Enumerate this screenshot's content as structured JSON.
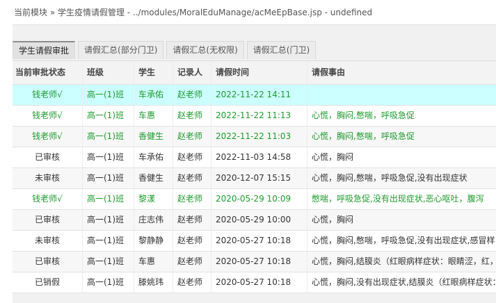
{
  "breadcrumb": "当前模块 » 学生疫情请假管理 - ../modules/MoralEduManage/acMeEpBase.jsp - undefined",
  "tabs": [
    {
      "label": "学生请假审批",
      "active": true
    },
    {
      "label": "请假汇总(部分门卫)",
      "active": false
    },
    {
      "label": "请假汇总(无权限)",
      "active": false
    },
    {
      "label": "请假汇总(门卫)",
      "active": false
    }
  ],
  "columns": {
    "status": "当前审批状态",
    "class": "班级",
    "student": "学生",
    "recorder": "记录人",
    "time": "请假时间",
    "reason": "请假事由"
  },
  "colors": {
    "approved_text": "#1f9a2e",
    "highlight_row": "#ccffff"
  },
  "rows": [
    {
      "status": "钱老师√",
      "class": "高一(1)班",
      "student": "车承佑",
      "recorder": "赵老师",
      "time": "2022-11-22 14:11",
      "reason": ""
    },
    {
      "status": "钱老师√",
      "class": "高一(1)班",
      "student": "车惠",
      "recorder": "赵老师",
      "time": "2022-11-22 11:13",
      "reason": "心慌，胸闷,憋喘，呼吸急促"
    },
    {
      "status": "钱老师√",
      "class": "高一(1)班",
      "student": "香健生",
      "recorder": "赵老师",
      "time": "2022-11-22 11:03",
      "reason": "心慌，胸闷,憋喘，呼吸急促"
    },
    {
      "status": "已审核",
      "class": "高一(1)班",
      "student": "车承佑",
      "recorder": "赵老师",
      "time": "2022-11-03 14:58",
      "reason": "心慌，胸闷"
    },
    {
      "status": "未审核",
      "class": "高一(1)班",
      "student": "香健生",
      "recorder": "赵老师",
      "time": "2020-12-07 15:15",
      "reason": "心慌，胸闷,憋喘，呼吸急促,没有出现症状"
    },
    {
      "status": "钱老师√",
      "class": "高一(1)班",
      "student": "黎漾",
      "recorder": "赵老师",
      "time": "2020-05-29 10:09",
      "reason": "憋喘，呼吸急促,没有出现症状,恶心呕吐，腹泻"
    },
    {
      "status": "已审核",
      "class": "高一(1)班",
      "student": "庄志伟",
      "recorder": "赵老师",
      "time": "2020-05-29 10:00",
      "reason": "心慌，胸闷"
    },
    {
      "status": "未审核",
      "class": "高一(1)班",
      "student": "黎静静",
      "recorder": "赵老师",
      "time": "2020-05-27 10:18",
      "reason": "心慌，胸闷,憋喘，呼吸急促,没有出现症状,感冒样"
    },
    {
      "status": "已审核",
      "class": "高一(1)班",
      "student": "车惠",
      "recorder": "赵老师",
      "time": "2020-05-27 10:18",
      "reason": "心慌，胸闷,结膜炎（红眼病样症状：眼睛涩，红，"
    },
    {
      "status": "已销假",
      "class": "高一(1)班",
      "student": "滕姚玮",
      "recorder": "赵老师",
      "time": "2020-05-27 10:18",
      "reason": "心慌，胸闷,没有出现症状,结膜炎（红眼病样症状："
    }
  ]
}
